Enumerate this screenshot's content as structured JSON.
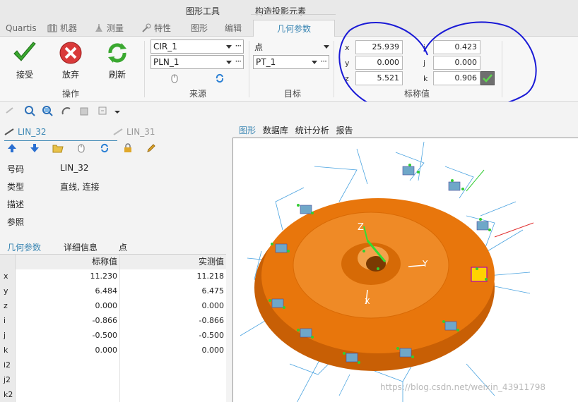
{
  "context_tabs": [
    "图形工具",
    "构造投影元素"
  ],
  "tabs": [
    {
      "label": "Quartis",
      "icon": ""
    },
    {
      "label": "机器",
      "icon": "machine-icon"
    },
    {
      "label": "测量",
      "icon": "measure-icon"
    },
    {
      "label": "特性",
      "icon": "feature-icon"
    },
    {
      "label": "图形",
      "icon": ""
    },
    {
      "label": "编辑",
      "icon": ""
    },
    {
      "label": "几何参数",
      "icon": ""
    }
  ],
  "ribbon": {
    "operation": {
      "label": "操作",
      "accept": "接受",
      "discard": "放弃",
      "refresh": "刷新"
    },
    "source": {
      "label": "来源",
      "combo1": "CIR_1",
      "combo2": "PLN_1"
    },
    "target": {
      "label": "目标",
      "type": "点",
      "name": "PT_1"
    },
    "nominal": {
      "label": "标称值",
      "x_label": "x",
      "x": "25.939",
      "y_label": "y",
      "y": "0.000",
      "z_label": "z",
      "z": "5.521",
      "i_label": "i",
      "i": "0.423",
      "j_label": "j",
      "j": "0.000",
      "k_label": "k",
      "k": "0.906"
    }
  },
  "left": {
    "current_feature": "LIN_32",
    "other_feature": "LIN_31",
    "props": [
      {
        "key": "号码",
        "value": "LIN_32"
      },
      {
        "key": "类型",
        "value": "直线, 连接"
      },
      {
        "key": "描述",
        "value": ""
      },
      {
        "key": "参照",
        "value": ""
      }
    ],
    "subtabs": [
      "几何参数",
      "详细信息",
      "点"
    ],
    "grid": {
      "headers": [
        "",
        "标称值",
        "实测值"
      ],
      "rows": [
        [
          "x",
          "11.230",
          "11.218"
        ],
        [
          "y",
          "6.484",
          "6.475"
        ],
        [
          "z",
          "0.000",
          "0.000"
        ],
        [
          "i",
          "-0.866",
          "-0.866"
        ],
        [
          "j",
          "-0.500",
          "-0.500"
        ],
        [
          "k",
          "0.000",
          "0.000"
        ],
        [
          "i2",
          "",
          ""
        ],
        [
          "j2",
          "",
          ""
        ],
        [
          "k2",
          "",
          ""
        ]
      ]
    }
  },
  "view": {
    "tabs": [
      "图形",
      "数据库",
      "统计分析",
      "报告"
    ],
    "axis_labels": {
      "z": "Z",
      "y": "Y",
      "x": "X"
    },
    "watermark": "https://blog.csdn.net/weixin_43911798"
  },
  "colors": {
    "accent": "#3a86b3",
    "part_orange": "#e8760c",
    "annotation_blue": "#1a1ad6",
    "probe_green": "#33cc33"
  }
}
